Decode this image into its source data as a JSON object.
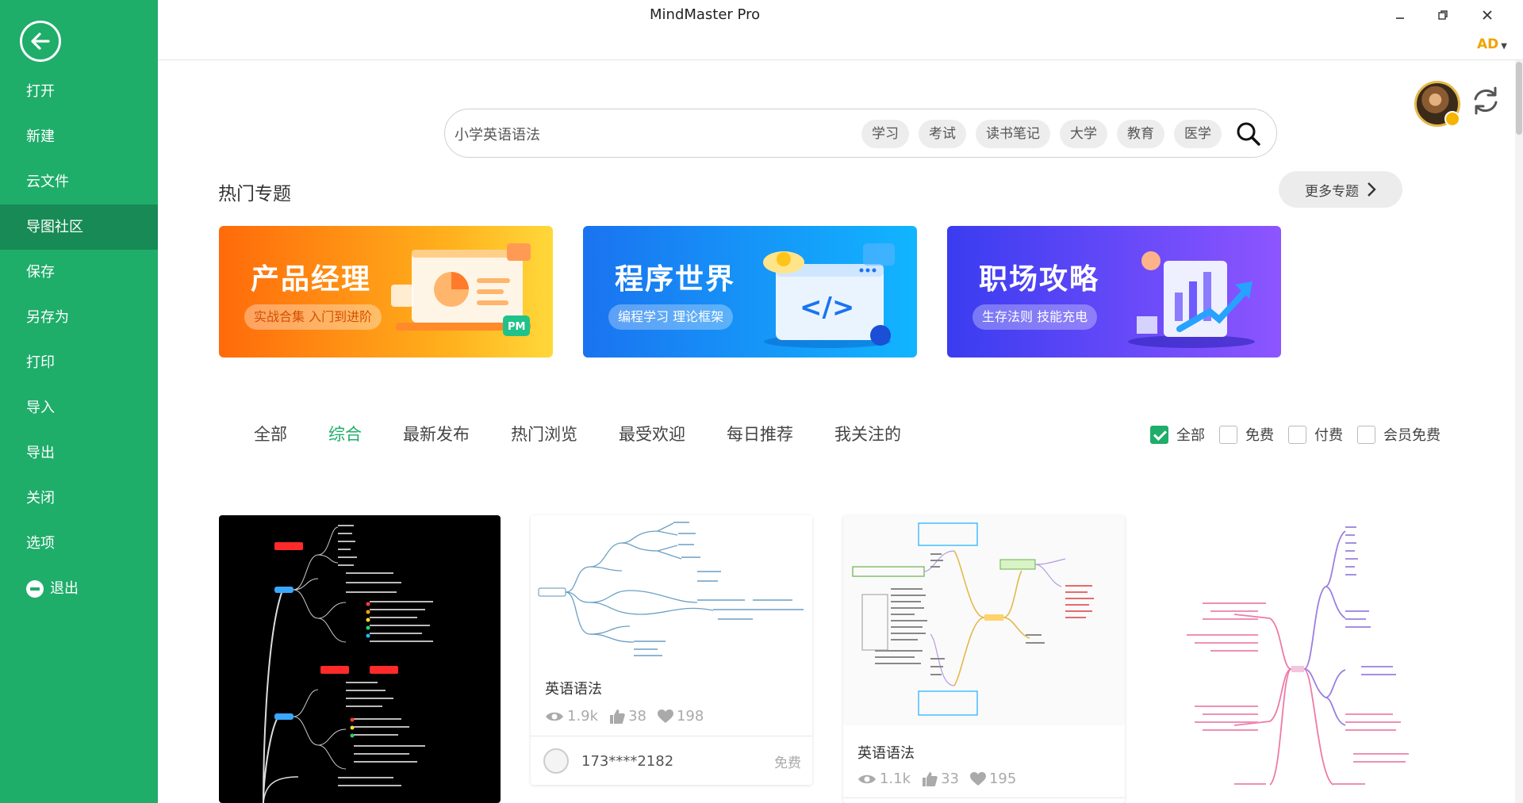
{
  "app": {
    "title": "MindMaster Pro",
    "user_tag": "AD"
  },
  "sidebar": {
    "items": [
      {
        "label": "打开",
        "key": "open"
      },
      {
        "label": "新建",
        "key": "new"
      },
      {
        "label": "云文件",
        "key": "cloud"
      },
      {
        "label": "导图社区",
        "key": "community",
        "active": true
      },
      {
        "label": "保存",
        "key": "save"
      },
      {
        "label": "另存为",
        "key": "saveas"
      },
      {
        "label": "打印",
        "key": "print"
      },
      {
        "label": "导入",
        "key": "import"
      },
      {
        "label": "导出",
        "key": "export"
      },
      {
        "label": "关闭",
        "key": "close"
      },
      {
        "label": "选项",
        "key": "options"
      }
    ],
    "exit_label": "退出"
  },
  "search": {
    "value": "小学英语语法",
    "tags": [
      "学习",
      "考试",
      "读书笔记",
      "大学",
      "教育",
      "医学"
    ]
  },
  "hot": {
    "title": "热门专题",
    "more_label": "更多专题",
    "banners": [
      {
        "title": "产品经理",
        "subtitle": "实战合集 入门到进阶"
      },
      {
        "title": "程序世界",
        "subtitle": "编程学习 理论框架"
      },
      {
        "title": "职场攻略",
        "subtitle": "生存法则 技能充电"
      }
    ]
  },
  "tabs": [
    "全部",
    "综合",
    "最新发布",
    "热门浏览",
    "最受欢迎",
    "每日推荐",
    "我关注的"
  ],
  "active_tab": "综合",
  "filters": [
    {
      "label": "全部",
      "checked": true
    },
    {
      "label": "免费",
      "checked": false
    },
    {
      "label": "付费",
      "checked": false
    },
    {
      "label": "会员免费",
      "checked": false
    }
  ],
  "cards": [
    {
      "title": "英语语法",
      "views": "1.9k",
      "likes": "38",
      "favorites": "198",
      "author": "173****2182",
      "price": "免费"
    },
    {
      "title": "英语语法",
      "views": "1.1k",
      "likes": "33",
      "favorites": "195"
    }
  ],
  "colors": {
    "brand": "#1fad6a",
    "brand_dark": "#178a55",
    "accent": "#f0a400"
  }
}
